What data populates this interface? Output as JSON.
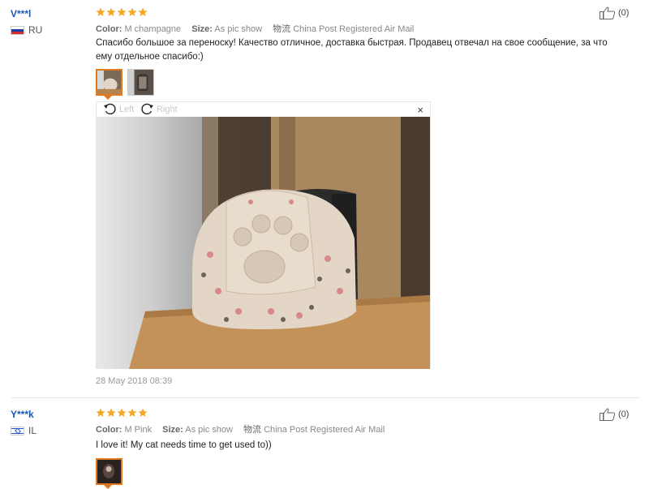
{
  "reviews": [
    {
      "user": "V***l",
      "country": "RU",
      "rating": 5,
      "color_label": "Color:",
      "color_value": "M champagne",
      "size_label": "Size:",
      "size_value": "As pic show",
      "ship_label": "物流",
      "ship_value": "China Post Registered Air Mail",
      "text": "Спасибо большое за переноску! Качество отличное, доставка быстрая. Продавец отвечал на свое сообщение, за что ему отдельное спасибо:)",
      "helpful_count": "(0)",
      "viewer": {
        "left_label": "Left",
        "right_label": "Right",
        "close_label": "×"
      },
      "date": "28 May 2018 08:39"
    },
    {
      "user": "Y***k",
      "country": "IL",
      "rating": 5,
      "color_label": "Color:",
      "color_value": "M Pink",
      "size_label": "Size:",
      "size_value": "As pic show",
      "ship_label": "物流",
      "ship_value": "China Post Registered Air Mail",
      "text": "I love it! My cat needs time to get used to))",
      "helpful_count": "(0)"
    }
  ],
  "colors": {
    "accent_orange": "#e07a1f",
    "star_orange": "#f5a623",
    "user_blue": "#1a56b8"
  },
  "icons": [
    "star-icon",
    "thumbs-up-icon",
    "rotate-left-icon",
    "rotate-right-icon",
    "close-icon",
    "flag-ru-icon",
    "flag-il-icon"
  ]
}
